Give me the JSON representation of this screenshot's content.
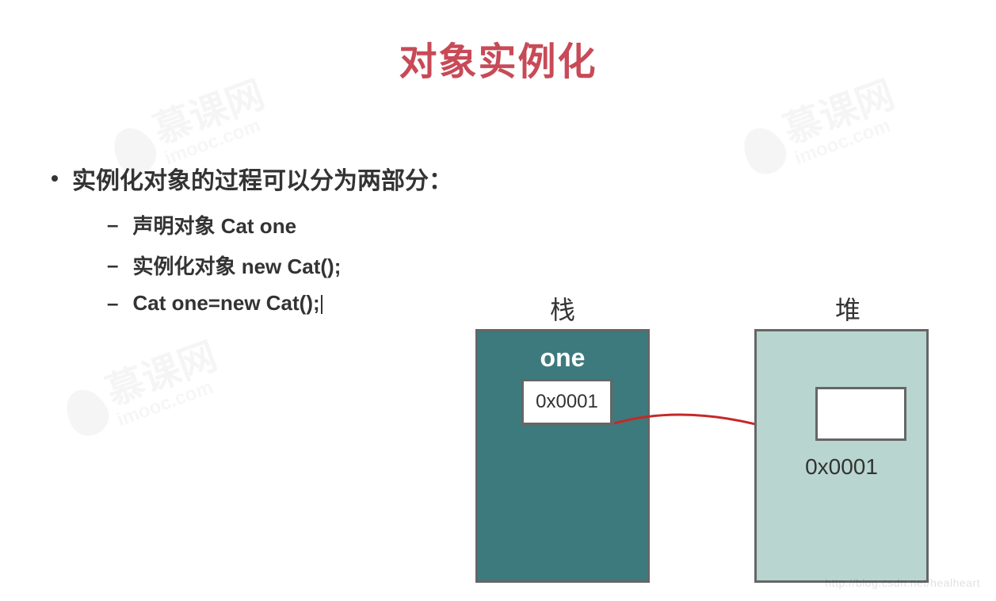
{
  "title": "对象实例化",
  "bullet_main": "实例化对象的过程可以分为两部分：",
  "sub_items": [
    "声明对象   Cat one",
    "实例化对象   new Cat();",
    "Cat one=new Cat();"
  ],
  "diagram": {
    "stack_label": "栈",
    "heap_label": "堆",
    "stack_var_name": "one",
    "stack_box_value": "0x0001",
    "heap_address": "0x0001",
    "arrow_color": "#c62828"
  },
  "watermark": {
    "cn": "慕课网",
    "en": "imooc.com"
  },
  "footer_url": "http://blog.csdn.net/healheart"
}
